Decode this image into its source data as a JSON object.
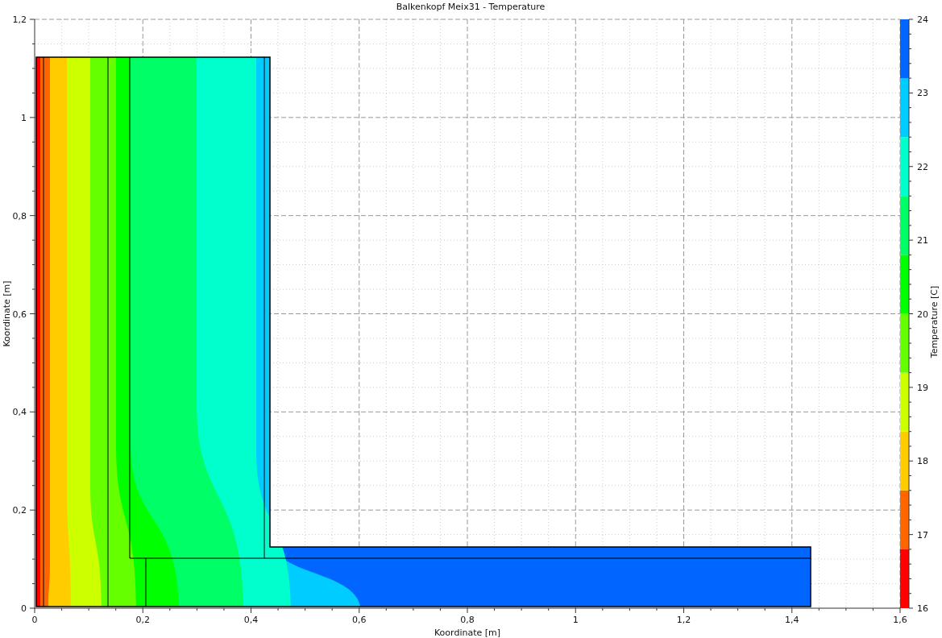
{
  "title": "Balkenkopf Meix31 - Temperature",
  "x_axis": {
    "label": "Koordinate [m]",
    "ticks": [
      "0",
      "0,2",
      "0,4",
      "0,6",
      "0,8",
      "1",
      "1,2",
      "1,4",
      "1,6"
    ]
  },
  "y_axis": {
    "label": "Koordinate [m]",
    "ticks": [
      "1,2",
      "1",
      "0,8",
      "0,6",
      "0,4",
      "0,2",
      "0"
    ]
  },
  "colorbar": {
    "label": "Temperature [C]",
    "ticks": [
      "24",
      "23",
      "22",
      "21",
      "20",
      "19",
      "18",
      "17",
      "16"
    ],
    "bands": [
      {
        "color": "#ff0000"
      },
      {
        "color": "#ff6600"
      },
      {
        "color": "#ffcc00"
      },
      {
        "color": "#ccff00"
      },
      {
        "color": "#66ff00"
      },
      {
        "color": "#00ff00"
      },
      {
        "color": "#00ff66"
      },
      {
        "color": "#00ffcc"
      },
      {
        "color": "#00ccff"
      },
      {
        "color": "#0066ff"
      }
    ]
  }
}
